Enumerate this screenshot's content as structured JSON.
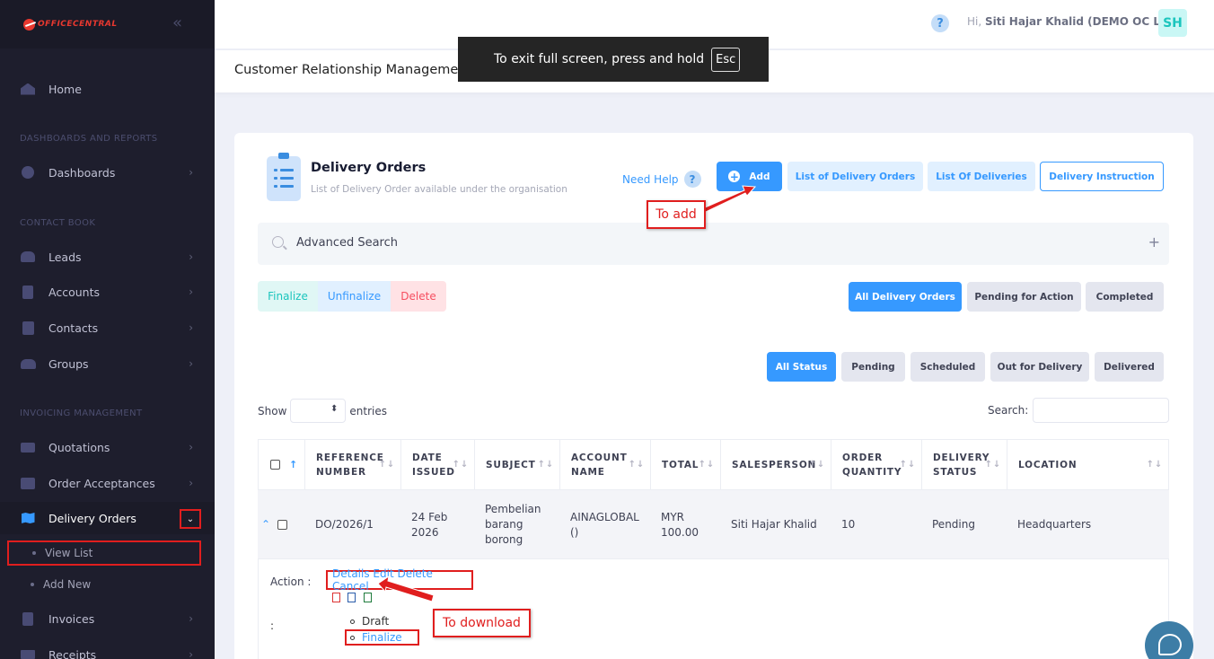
{
  "brand": {
    "logo_text": "OFFICECENTRAL"
  },
  "sidebar": {
    "home": "Home",
    "section_dashboards": "DASHBOARDS AND REPORTS",
    "dashboards": "Dashboards",
    "section_contact": "CONTACT BOOK",
    "leads": "Leads",
    "accounts": "Accounts",
    "contacts": "Contacts",
    "groups": "Groups",
    "section_invoicing": "INVOICING MANAGEMENT",
    "quotations": "Quotations",
    "order_acceptances": "Order Acceptances",
    "delivery_orders": "Delivery Orders",
    "view_list": "View List",
    "add_new": "Add New",
    "invoices": "Invoices",
    "receipts": "Receipts"
  },
  "header": {
    "greeting_prefix": "Hi,",
    "user_name": "Siti Hajar Khalid (DEMO OC LITE)",
    "avatar_initials": "SH",
    "help_glyph": "?"
  },
  "subheader": {
    "title": "Customer Relationship Management"
  },
  "fullscreen_toast": {
    "text": "To exit full screen, press and hold",
    "key": "Esc"
  },
  "card": {
    "title": "Delivery Orders",
    "subtitle": "List of Delivery Order available under the organisation",
    "need_help": "Need Help",
    "add": "Add",
    "list_delivery_orders": "List of Delivery Orders",
    "list_deliveries": "List Of Deliveries",
    "delivery_instruction": "Delivery Instruction"
  },
  "annotations": {
    "to_add": "To add",
    "to_download": "To download"
  },
  "advanced_search": {
    "label": "Advanced Search",
    "plus": "+"
  },
  "bulk_actions": {
    "finalize": "Finalize",
    "unfinalize": "Unfinalize",
    "delete": "Delete"
  },
  "order_filters": {
    "all": "All Delivery Orders",
    "pending_action": "Pending for Action",
    "completed": "Completed"
  },
  "status_filters": {
    "all": "All Status",
    "pending": "Pending",
    "scheduled": "Scheduled",
    "out_for_delivery": "Out for Delivery",
    "delivered": "Delivered"
  },
  "table_controls": {
    "show": "Show",
    "entries": "entries",
    "search": "Search:"
  },
  "table": {
    "headers": {
      "reference_1": "REFERENCE",
      "reference_2": "NUMBER",
      "date_1": "DATE",
      "date_2": "ISSUED",
      "subject": "SUBJECT",
      "account_1": "ACCOUNT",
      "account_2": "NAME",
      "total": "TOTAL",
      "salesperson": "SALESPERSON",
      "qty_1": "ORDER",
      "qty_2": "QUANTITY",
      "status_1": "DELIVERY",
      "status_2": "STATUS",
      "location": "LOCATION"
    },
    "row": {
      "reference": "DO/2026/1",
      "date_1": "24 Feb",
      "date_2": "2026",
      "subject_1": "Pembelian",
      "subject_2": "barang",
      "subject_3": "borong",
      "account_1": "AINAGLOBAL",
      "account_2": "()",
      "total_1": "MYR",
      "total_2": "100.00",
      "salesperson": "Siti Hajar Khalid",
      "quantity": "10",
      "status": "Pending",
      "location": "Headquarters"
    },
    "expanded": {
      "action_label": "Action :",
      "action_links": "Details Edit Delete Cancel",
      "colon": ":",
      "status_draft": "Draft",
      "status_finalize": "Finalize"
    }
  },
  "colors": {
    "primary": "#3699ff",
    "sidebar_bg": "#1e1e2d",
    "annotation_red": "#e01e1e"
  }
}
